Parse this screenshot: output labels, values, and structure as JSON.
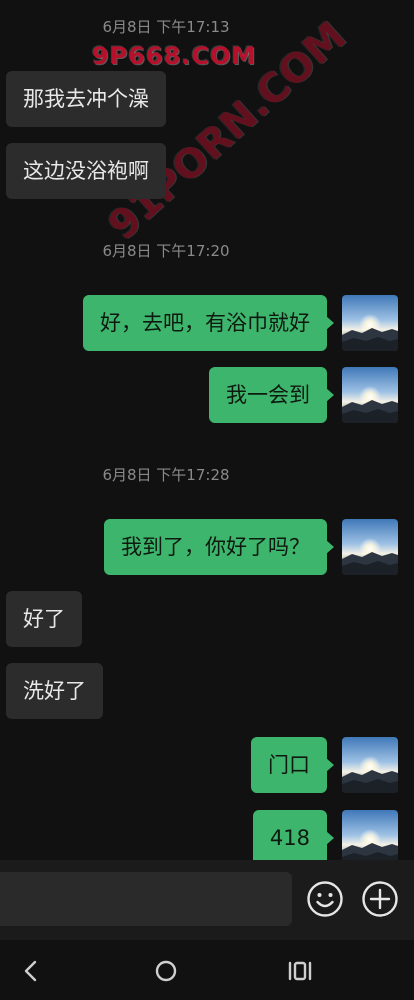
{
  "watermarks": {
    "top": "9P668.COM",
    "diagonal": "91PORN.COM"
  },
  "messages": [
    {
      "type": "timestamp",
      "text": "6月8日  下午17:13"
    },
    {
      "type": "in",
      "text": "那我去冲个澡"
    },
    {
      "type": "in",
      "text": "这边没浴袍啊"
    },
    {
      "type": "timestamp",
      "text": "6月8日  下午17:20"
    },
    {
      "type": "out",
      "text": "好，去吧，有浴巾就好"
    },
    {
      "type": "out",
      "text": "我一会到"
    },
    {
      "type": "timestamp",
      "text": "6月8日  下午17:28"
    },
    {
      "type": "out",
      "text": "我到了，你好了吗？"
    },
    {
      "type": "in",
      "text": "好了"
    },
    {
      "type": "in",
      "text": "洗好了"
    },
    {
      "type": "out",
      "text": "门口"
    },
    {
      "type": "out",
      "text": "418"
    }
  ],
  "input_bar": {
    "message_value": "",
    "emoji_icon": "emoji-icon",
    "plus_icon": "plus-icon"
  },
  "nav": {
    "back_icon": "back-icon",
    "home_icon": "home-icon",
    "recents_icon": "recents-icon"
  },
  "colors": {
    "background": "#111111",
    "incoming_bubble": "#2c2c2c",
    "outgoing_bubble": "#3eb56d",
    "timestamp": "#8a8a8a",
    "watermark": "#c8102e"
  }
}
